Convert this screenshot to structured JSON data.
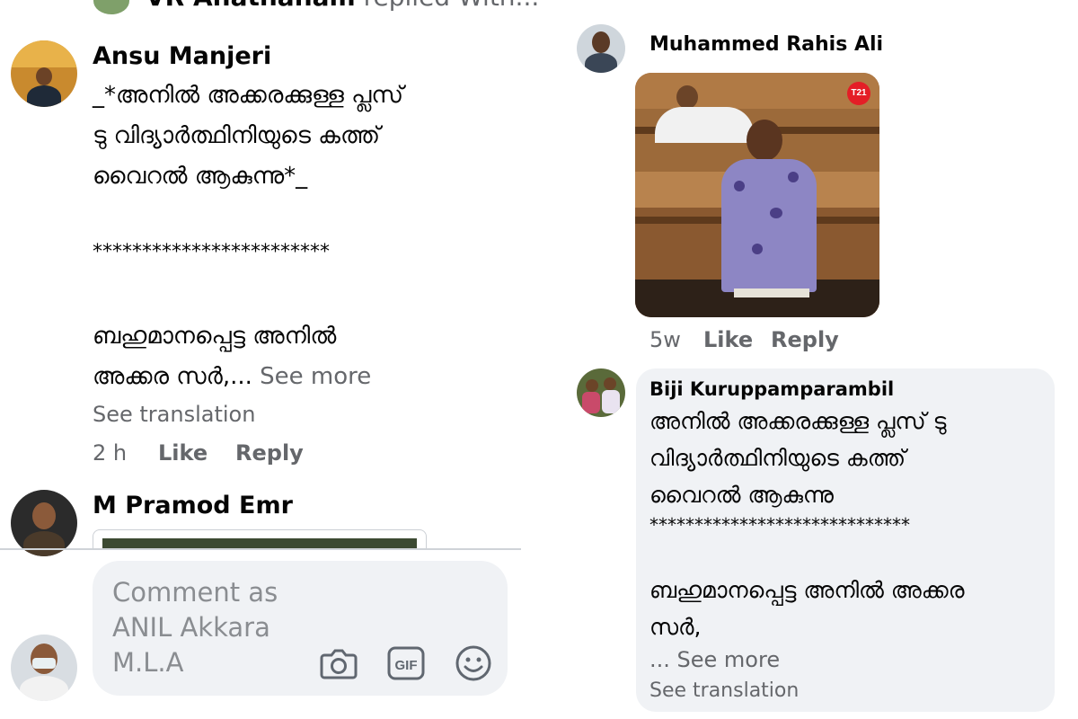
{
  "top_partial": {
    "name": "VR Anathanam",
    "suffix": "replied With..."
  },
  "left_comment_1": {
    "author": "Ansu Manjeri",
    "text": "_*അനിൽ അക്കരക്കുള്ള പ്ലസ്\nടു വിദ്യാർത്ഥിനിയുടെ കത്ത്\nവൈറൽ ആകുന്നു*_",
    "stars": "************************",
    "text2": "ബഹുമാനപ്പെട്ട അനിൽ\nഅക്കര സർ,...",
    "see_more": "See more",
    "see_translation": "See translation",
    "time": "2 h",
    "like": "Like",
    "reply": "Reply"
  },
  "left_comment_2": {
    "author": "M Pramod Emr"
  },
  "composer": {
    "placeholder": "Comment as\nANIL Akkara\nM.L.A",
    "icons": [
      "camera-icon",
      "gif-icon",
      "emoji-icon"
    ]
  },
  "right_comment_1": {
    "author": "Muhammed Rahis Ali",
    "badge": "T21",
    "time": "5w",
    "like": "Like",
    "reply": "Reply"
  },
  "right_comment_2": {
    "author": "Biji Kuruppamparambil",
    "text": "അനിൽ അക്കരക്കുള്ള പ്ലസ് ടു\nവിദ്യാർത്ഥിനിയുടെ കത്ത്\nവൈറൽ ആകുന്നു",
    "stars": "*****************************",
    "text2": "ബഹുമാനപ്പെട്ട അനിൽ അക്കര\nസർ,",
    "see_more": "... See more",
    "see_translation": "See translation"
  },
  "colors": {
    "secondary_text": "#65676b",
    "bubble_bg": "#f0f2f5",
    "badge_red": "#e41e26"
  }
}
